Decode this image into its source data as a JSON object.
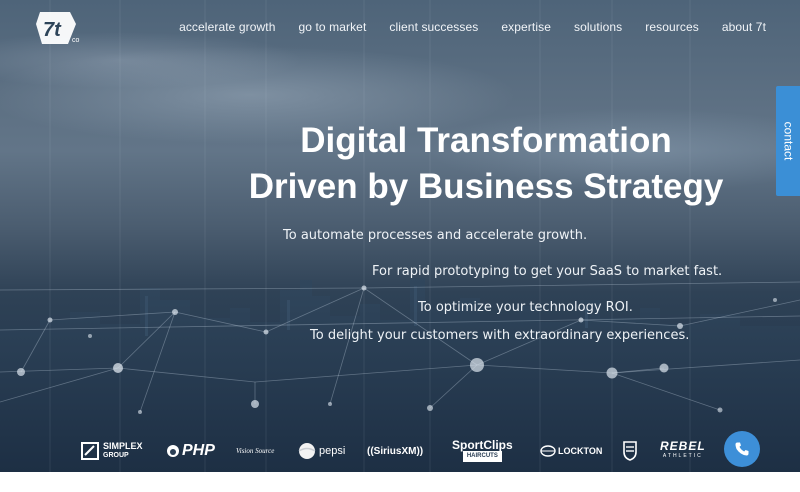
{
  "brand": {
    "logo_text": "7t",
    "logo_suffix": "co"
  },
  "nav": [
    {
      "label": "accelerate growth"
    },
    {
      "label": "go to market"
    },
    {
      "label": "client successes"
    },
    {
      "label": "expertise"
    },
    {
      "label": "solutions"
    },
    {
      "label": "resources"
    },
    {
      "label": "about 7t"
    }
  ],
  "contact_tab": "contact",
  "hero": {
    "headline_line1": "Digital Transformation",
    "headline_line2": "Driven by Business Strategy",
    "taglines": [
      "To automate processes and accelerate growth.",
      "For rapid prototyping to get your SaaS to market fast.",
      "To optimize your technology ROI.",
      "To delight your customers with extraordinary experiences."
    ]
  },
  "clients": [
    {
      "name": "SIMPLEX",
      "sub": "GROUP"
    },
    {
      "name": "PHP"
    },
    {
      "name": "Vision Source"
    },
    {
      "name": "pepsi"
    },
    {
      "name": "SiriusXM"
    },
    {
      "name": "SportClips",
      "sub": "HAIRCUTS"
    },
    {
      "name": "LOCKTON"
    },
    {
      "name": "shield"
    },
    {
      "name": "REBEL",
      "sub": "ATHLETIC"
    }
  ],
  "colors": {
    "accent": "#3b8fd6",
    "text": "#ffffff"
  }
}
